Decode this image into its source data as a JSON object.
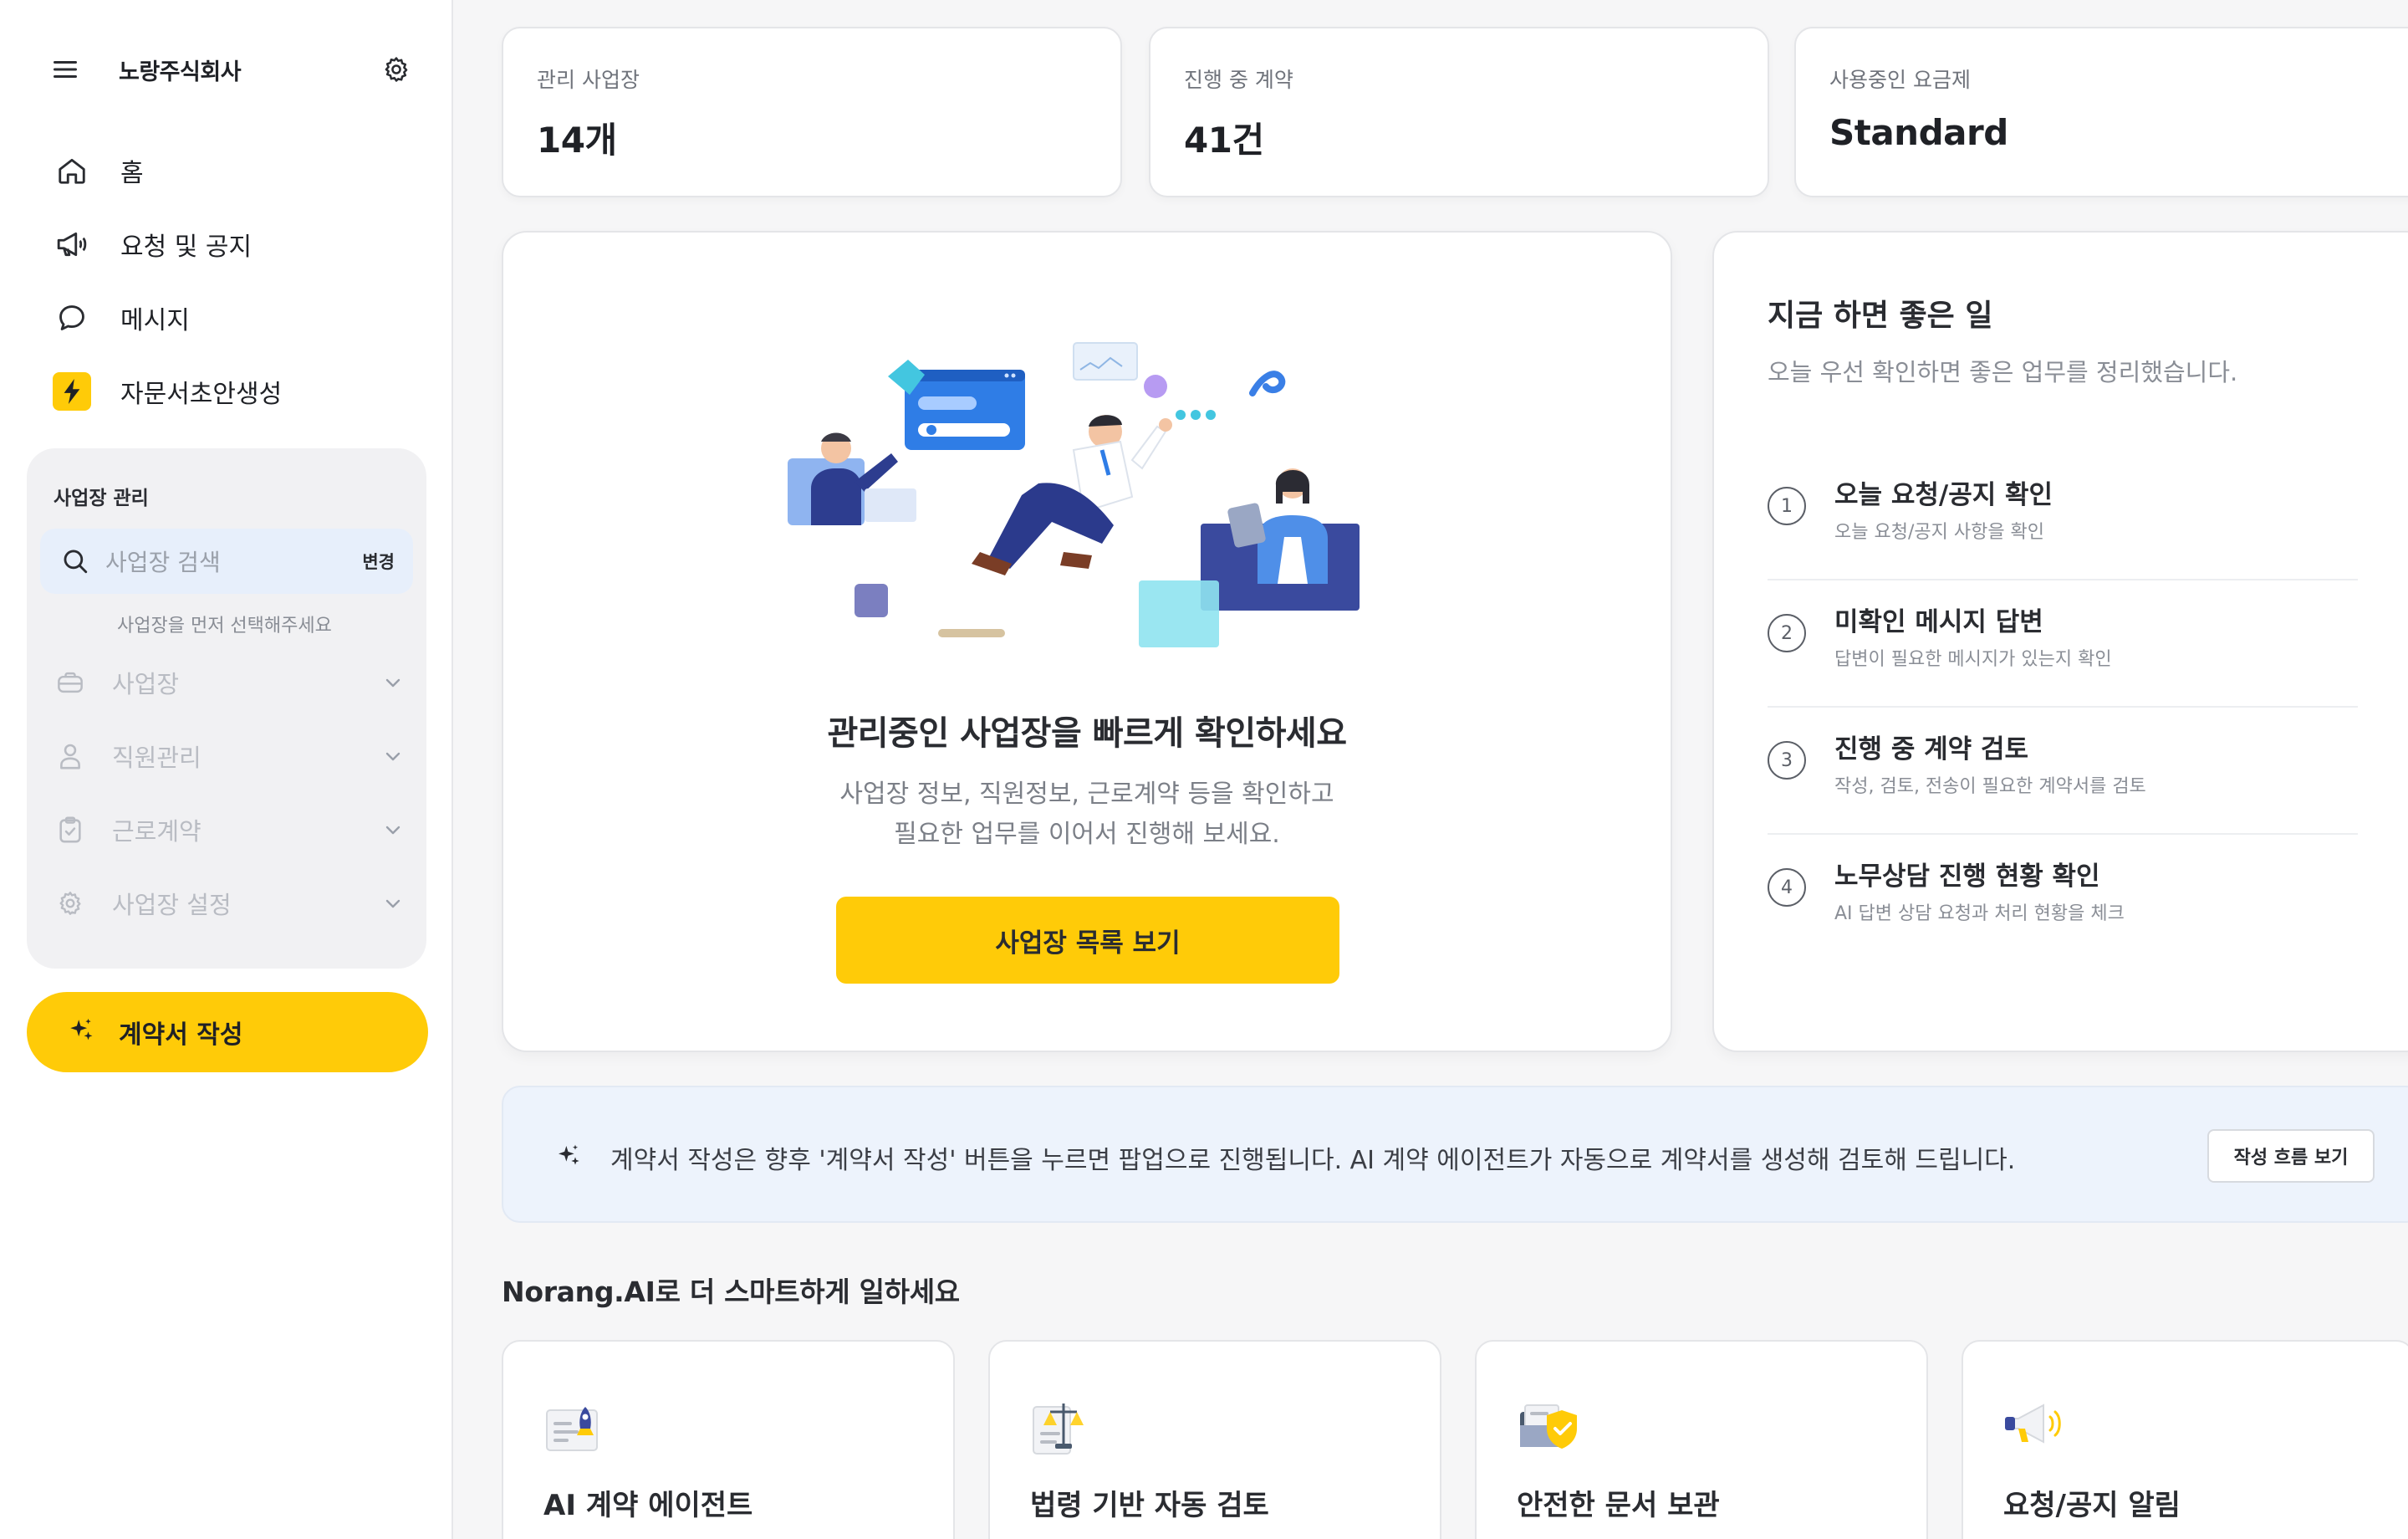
{
  "colors": {
    "accent": "#ffcb08",
    "sidebar_bg": "#ffffff",
    "page_bg": "#f6f6f7",
    "notice_bg": "#edf3fc"
  },
  "sidebar": {
    "company_name": "노랑주식회사",
    "nav": [
      {
        "label": "홈",
        "icon": "home-icon"
      },
      {
        "label": "요청 및 공지",
        "icon": "megaphone-icon"
      },
      {
        "label": "메시지",
        "icon": "chat-icon"
      },
      {
        "label": "자문서초안생성",
        "icon": "lightning-icon"
      }
    ],
    "workspace": {
      "title": "사업장 관리",
      "search_placeholder": "사업장 검색",
      "change_label": "변경",
      "hint": "사업장을 먼저 선택해주세요",
      "items": [
        {
          "label": "사업장",
          "icon": "briefcase-icon"
        },
        {
          "label": "직원관리",
          "icon": "person-icon"
        },
        {
          "label": "근로계약",
          "icon": "clipboard-check-icon"
        },
        {
          "label": "사업장 설정",
          "icon": "gear-icon"
        }
      ]
    },
    "cta_label": "계약서 작성"
  },
  "stats": [
    {
      "label": "관리 사업장",
      "value": "14개"
    },
    {
      "label": "진행 중 계약",
      "value": "41건"
    },
    {
      "label": "사용중인 요금제",
      "value": "Standard"
    }
  ],
  "hero": {
    "title": "관리중인 사업장을 빠르게 확인하세요",
    "subtitle_line1": "사업장 정보, 직원정보, 근로계약 등을 확인하고",
    "subtitle_line2": "필요한 업무를 이어서 진행해 보세요.",
    "button_label": "사업장 목록 보기"
  },
  "todo": {
    "title": "지금 하면 좋은 일",
    "subtitle": "오늘 우선 확인하면 좋은 업무를 정리했습니다.",
    "items": [
      {
        "num": "1",
        "title": "오늘 요청/공지 확인",
        "desc": "오늘 요청/공지 사항을 확인"
      },
      {
        "num": "2",
        "title": "미확인 메시지 답변",
        "desc": "답변이 필요한 메시지가 있는지 확인"
      },
      {
        "num": "3",
        "title": "진행 중 계약 검토",
        "desc": "작성, 검토, 전송이 필요한 계약서를 검토"
      },
      {
        "num": "4",
        "title": "노무상담 진행 현황 확인",
        "desc": "AI 답변 상담 요청과 처리 현황을 체크"
      }
    ]
  },
  "notice": {
    "text": "계약서 작성은 향후 '계약서 작성' 버튼을 누르면 팝업으로 진행됩니다. AI 계약 에이전트가 자동으로 계약서를 생성해 검토해 드립니다.",
    "button_label": "작성 흐름 보기"
  },
  "features": {
    "section_title": "Norang.AI로 더 스마트하게 일하세요",
    "cards": [
      {
        "title": "AI 계약 에이전트",
        "icon": "document-rocket-icon"
      },
      {
        "title": "법령 기반 자동 검토",
        "icon": "scale-icon"
      },
      {
        "title": "안전한 문서 보관",
        "icon": "folder-shield-icon"
      },
      {
        "title": "요청/공지 알림",
        "icon": "megaphone-icon"
      }
    ]
  }
}
